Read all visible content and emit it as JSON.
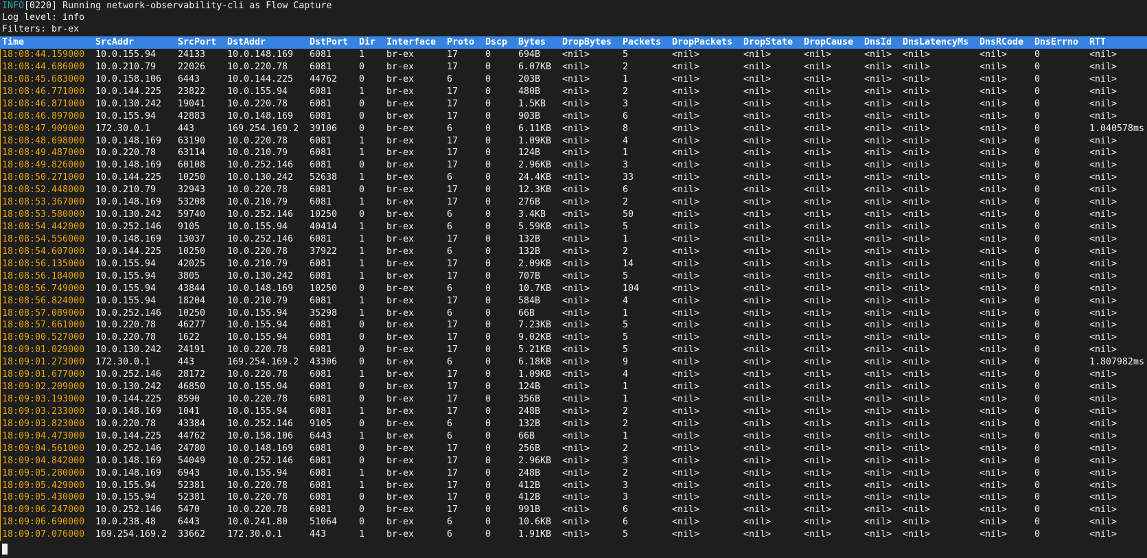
{
  "log": {
    "info_tag": "INFO",
    "info_message": "[0220] Running network-observability-cli as Flow Capture",
    "log_level": "Log level: info",
    "filters": "Filters: br-ex"
  },
  "colors": {
    "background": "#1e1e1e",
    "header_bg": "#3584e4",
    "time_text": "#e5a50a",
    "info_tag": "#2aa1b3",
    "text": "#f0f0f0"
  },
  "table": {
    "columns": [
      "Time",
      "SrcAddr",
      "SrcPort",
      "DstAddr",
      "DstPort",
      "Dir",
      "Interface",
      "Proto",
      "Dscp",
      "Bytes",
      "DropBytes",
      "Packets",
      "DropPackets",
      "DropState",
      "DropCause",
      "DnsId",
      "DnsLatencyMs",
      "DnsRCode",
      "DnsErrno",
      "RTT"
    ],
    "rows": [
      [
        "18:08:44.159000",
        "10.0.155.94",
        "24133",
        "10.0.148.169",
        "6081",
        "1",
        "br-ex",
        "17",
        "0",
        "694B",
        "<nil>",
        "5",
        "<nil>",
        "<nil>",
        "<nil>",
        "<nil>",
        "<nil>",
        "<nil>",
        "0",
        "<nil>"
      ],
      [
        "18:08:44.686000",
        "10.0.210.79",
        "22026",
        "10.0.220.78",
        "6081",
        "0",
        "br-ex",
        "17",
        "0",
        "6.07KB",
        "<nil>",
        "2",
        "<nil>",
        "<nil>",
        "<nil>",
        "<nil>",
        "<nil>",
        "<nil>",
        "0",
        "<nil>"
      ],
      [
        "18:08:45.683000",
        "10.0.158.106",
        "6443",
        "10.0.144.225",
        "44762",
        "0",
        "br-ex",
        "6",
        "0",
        "203B",
        "<nil>",
        "1",
        "<nil>",
        "<nil>",
        "<nil>",
        "<nil>",
        "<nil>",
        "<nil>",
        "0",
        "<nil>"
      ],
      [
        "18:08:46.771000",
        "10.0.144.225",
        "23822",
        "10.0.155.94",
        "6081",
        "1",
        "br-ex",
        "17",
        "0",
        "480B",
        "<nil>",
        "2",
        "<nil>",
        "<nil>",
        "<nil>",
        "<nil>",
        "<nil>",
        "<nil>",
        "0",
        "<nil>"
      ],
      [
        "18:08:46.871000",
        "10.0.130.242",
        "19041",
        "10.0.220.78",
        "6081",
        "0",
        "br-ex",
        "17",
        "0",
        "1.5KB",
        "<nil>",
        "3",
        "<nil>",
        "<nil>",
        "<nil>",
        "<nil>",
        "<nil>",
        "<nil>",
        "0",
        "<nil>"
      ],
      [
        "18:08:46.897000",
        "10.0.155.94",
        "42883",
        "10.0.148.169",
        "6081",
        "0",
        "br-ex",
        "17",
        "0",
        "903B",
        "<nil>",
        "6",
        "<nil>",
        "<nil>",
        "<nil>",
        "<nil>",
        "<nil>",
        "<nil>",
        "0",
        "<nil>"
      ],
      [
        "18:08:47.909000",
        "172.30.0.1",
        "443",
        "169.254.169.2",
        "39106",
        "0",
        "br-ex",
        "6",
        "0",
        "6.11KB",
        "<nil>",
        "8",
        "<nil>",
        "<nil>",
        "<nil>",
        "<nil>",
        "<nil>",
        "<nil>",
        "0",
        "1.040578ms"
      ],
      [
        "18:08:48.698000",
        "10.0.148.169",
        "63190",
        "10.0.220.78",
        "6081",
        "1",
        "br-ex",
        "17",
        "0",
        "1.09KB",
        "<nil>",
        "4",
        "<nil>",
        "<nil>",
        "<nil>",
        "<nil>",
        "<nil>",
        "<nil>",
        "0",
        "<nil>"
      ],
      [
        "18:08:49.487000",
        "10.0.220.78",
        "63114",
        "10.0.210.79",
        "6081",
        "1",
        "br-ex",
        "17",
        "0",
        "124B",
        "<nil>",
        "1",
        "<nil>",
        "<nil>",
        "<nil>",
        "<nil>",
        "<nil>",
        "<nil>",
        "0",
        "<nil>"
      ],
      [
        "18:08:49.826000",
        "10.0.148.169",
        "60108",
        "10.0.252.146",
        "6081",
        "0",
        "br-ex",
        "17",
        "0",
        "2.96KB",
        "<nil>",
        "3",
        "<nil>",
        "<nil>",
        "<nil>",
        "<nil>",
        "<nil>",
        "<nil>",
        "0",
        "<nil>"
      ],
      [
        "18:08:50.271000",
        "10.0.144.225",
        "10250",
        "10.0.130.242",
        "52638",
        "1",
        "br-ex",
        "6",
        "0",
        "24.4KB",
        "<nil>",
        "33",
        "<nil>",
        "<nil>",
        "<nil>",
        "<nil>",
        "<nil>",
        "<nil>",
        "0",
        "<nil>"
      ],
      [
        "18:08:52.448000",
        "10.0.210.79",
        "32943",
        "10.0.220.78",
        "6081",
        "0",
        "br-ex",
        "17",
        "0",
        "12.3KB",
        "<nil>",
        "6",
        "<nil>",
        "<nil>",
        "<nil>",
        "<nil>",
        "<nil>",
        "<nil>",
        "0",
        "<nil>"
      ],
      [
        "18:08:53.367000",
        "10.0.148.169",
        "53208",
        "10.0.210.79",
        "6081",
        "1",
        "br-ex",
        "17",
        "0",
        "276B",
        "<nil>",
        "2",
        "<nil>",
        "<nil>",
        "<nil>",
        "<nil>",
        "<nil>",
        "<nil>",
        "0",
        "<nil>"
      ],
      [
        "18:08:53.580000",
        "10.0.130.242",
        "59740",
        "10.0.252.146",
        "10250",
        "0",
        "br-ex",
        "6",
        "0",
        "3.4KB",
        "<nil>",
        "50",
        "<nil>",
        "<nil>",
        "<nil>",
        "<nil>",
        "<nil>",
        "<nil>",
        "0",
        "<nil>"
      ],
      [
        "18:08:54.442000",
        "10.0.252.146",
        "9105",
        "10.0.155.94",
        "40414",
        "1",
        "br-ex",
        "6",
        "0",
        "5.59KB",
        "<nil>",
        "5",
        "<nil>",
        "<nil>",
        "<nil>",
        "<nil>",
        "<nil>",
        "<nil>",
        "0",
        "<nil>"
      ],
      [
        "18:08:54.556000",
        "10.0.148.169",
        "13037",
        "10.0.252.146",
        "6081",
        "1",
        "br-ex",
        "17",
        "0",
        "132B",
        "<nil>",
        "1",
        "<nil>",
        "<nil>",
        "<nil>",
        "<nil>",
        "<nil>",
        "<nil>",
        "0",
        "<nil>"
      ],
      [
        "18:08:54.607000",
        "10.0.144.225",
        "10250",
        "10.0.220.78",
        "37922",
        "1",
        "br-ex",
        "6",
        "0",
        "132B",
        "<nil>",
        "2",
        "<nil>",
        "<nil>",
        "<nil>",
        "<nil>",
        "<nil>",
        "<nil>",
        "0",
        "<nil>"
      ],
      [
        "18:08:56.135000",
        "10.0.155.94",
        "42025",
        "10.0.210.79",
        "6081",
        "1",
        "br-ex",
        "17",
        "0",
        "2.09KB",
        "<nil>",
        "14",
        "<nil>",
        "<nil>",
        "<nil>",
        "<nil>",
        "<nil>",
        "<nil>",
        "0",
        "<nil>"
      ],
      [
        "18:08:56.184000",
        "10.0.155.94",
        "3805",
        "10.0.130.242",
        "6081",
        "1",
        "br-ex",
        "17",
        "0",
        "707B",
        "<nil>",
        "5",
        "<nil>",
        "<nil>",
        "<nil>",
        "<nil>",
        "<nil>",
        "<nil>",
        "0",
        "<nil>"
      ],
      [
        "18:08:56.749000",
        "10.0.155.94",
        "43844",
        "10.0.148.169",
        "10250",
        "0",
        "br-ex",
        "6",
        "0",
        "10.7KB",
        "<nil>",
        "104",
        "<nil>",
        "<nil>",
        "<nil>",
        "<nil>",
        "<nil>",
        "<nil>",
        "0",
        "<nil>"
      ],
      [
        "18:08:56.824000",
        "10.0.155.94",
        "18204",
        "10.0.210.79",
        "6081",
        "1",
        "br-ex",
        "17",
        "0",
        "584B",
        "<nil>",
        "4",
        "<nil>",
        "<nil>",
        "<nil>",
        "<nil>",
        "<nil>",
        "<nil>",
        "0",
        "<nil>"
      ],
      [
        "18:08:57.089000",
        "10.0.252.146",
        "10250",
        "10.0.155.94",
        "35298",
        "1",
        "br-ex",
        "6",
        "0",
        "66B",
        "<nil>",
        "1",
        "<nil>",
        "<nil>",
        "<nil>",
        "<nil>",
        "<nil>",
        "<nil>",
        "0",
        "<nil>"
      ],
      [
        "18:08:57.661000",
        "10.0.220.78",
        "46277",
        "10.0.155.94",
        "6081",
        "0",
        "br-ex",
        "17",
        "0",
        "7.23KB",
        "<nil>",
        "5",
        "<nil>",
        "<nil>",
        "<nil>",
        "<nil>",
        "<nil>",
        "<nil>",
        "0",
        "<nil>"
      ],
      [
        "18:09:00.527000",
        "10.0.220.78",
        "1622",
        "10.0.155.94",
        "6081",
        "0",
        "br-ex",
        "17",
        "0",
        "9.02KB",
        "<nil>",
        "5",
        "<nil>",
        "<nil>",
        "<nil>",
        "<nil>",
        "<nil>",
        "<nil>",
        "0",
        "<nil>"
      ],
      [
        "18:09:01.029000",
        "10.0.130.242",
        "24191",
        "10.0.220.78",
        "6081",
        "0",
        "br-ex",
        "17",
        "0",
        "5.21KB",
        "<nil>",
        "5",
        "<nil>",
        "<nil>",
        "<nil>",
        "<nil>",
        "<nil>",
        "<nil>",
        "0",
        "<nil>"
      ],
      [
        "18:09:01.273000",
        "172.30.0.1",
        "443",
        "169.254.169.2",
        "43306",
        "0",
        "br-ex",
        "6",
        "0",
        "6.18KB",
        "<nil>",
        "9",
        "<nil>",
        "<nil>",
        "<nil>",
        "<nil>",
        "<nil>",
        "<nil>",
        "0",
        "1.807982ms"
      ],
      [
        "18:09:01.677000",
        "10.0.252.146",
        "28172",
        "10.0.220.78",
        "6081",
        "1",
        "br-ex",
        "17",
        "0",
        "1.09KB",
        "<nil>",
        "4",
        "<nil>",
        "<nil>",
        "<nil>",
        "<nil>",
        "<nil>",
        "<nil>",
        "0",
        "<nil>"
      ],
      [
        "18:09:02.209000",
        "10.0.130.242",
        "46850",
        "10.0.155.94",
        "6081",
        "0",
        "br-ex",
        "17",
        "0",
        "124B",
        "<nil>",
        "1",
        "<nil>",
        "<nil>",
        "<nil>",
        "<nil>",
        "<nil>",
        "<nil>",
        "0",
        "<nil>"
      ],
      [
        "18:09:03.193000",
        "10.0.144.225",
        "8590",
        "10.0.220.78",
        "6081",
        "0",
        "br-ex",
        "17",
        "0",
        "356B",
        "<nil>",
        "1",
        "<nil>",
        "<nil>",
        "<nil>",
        "<nil>",
        "<nil>",
        "<nil>",
        "0",
        "<nil>"
      ],
      [
        "18:09:03.233000",
        "10.0.148.169",
        "1041",
        "10.0.155.94",
        "6081",
        "1",
        "br-ex",
        "17",
        "0",
        "248B",
        "<nil>",
        "2",
        "<nil>",
        "<nil>",
        "<nil>",
        "<nil>",
        "<nil>",
        "<nil>",
        "0",
        "<nil>"
      ],
      [
        "18:09:03.823000",
        "10.0.220.78",
        "43384",
        "10.0.252.146",
        "9105",
        "0",
        "br-ex",
        "6",
        "0",
        "132B",
        "<nil>",
        "2",
        "<nil>",
        "<nil>",
        "<nil>",
        "<nil>",
        "<nil>",
        "<nil>",
        "0",
        "<nil>"
      ],
      [
        "18:09:04.473000",
        "10.0.144.225",
        "44762",
        "10.0.158.106",
        "6443",
        "1",
        "br-ex",
        "6",
        "0",
        "66B",
        "<nil>",
        "1",
        "<nil>",
        "<nil>",
        "<nil>",
        "<nil>",
        "<nil>",
        "<nil>",
        "0",
        "<nil>"
      ],
      [
        "18:09:04.561000",
        "10.0.252.146",
        "24780",
        "10.0.148.169",
        "6081",
        "0",
        "br-ex",
        "17",
        "0",
        "256B",
        "<nil>",
        "2",
        "<nil>",
        "<nil>",
        "<nil>",
        "<nil>",
        "<nil>",
        "<nil>",
        "0",
        "<nil>"
      ],
      [
        "18:09:04.842000",
        "10.0.148.169",
        "54049",
        "10.0.252.146",
        "6081",
        "0",
        "br-ex",
        "17",
        "0",
        "2.96KB",
        "<nil>",
        "3",
        "<nil>",
        "<nil>",
        "<nil>",
        "<nil>",
        "<nil>",
        "<nil>",
        "0",
        "<nil>"
      ],
      [
        "18:09:05.280000",
        "10.0.148.169",
        "6943",
        "10.0.155.94",
        "6081",
        "1",
        "br-ex",
        "17",
        "0",
        "248B",
        "<nil>",
        "2",
        "<nil>",
        "<nil>",
        "<nil>",
        "<nil>",
        "<nil>",
        "<nil>",
        "0",
        "<nil>"
      ],
      [
        "18:09:05.429000",
        "10.0.155.94",
        "52381",
        "10.0.220.78",
        "6081",
        "1",
        "br-ex",
        "17",
        "0",
        "412B",
        "<nil>",
        "3",
        "<nil>",
        "<nil>",
        "<nil>",
        "<nil>",
        "<nil>",
        "<nil>",
        "0",
        "<nil>"
      ],
      [
        "18:09:05.430000",
        "10.0.155.94",
        "52381",
        "10.0.220.78",
        "6081",
        "0",
        "br-ex",
        "17",
        "0",
        "412B",
        "<nil>",
        "3",
        "<nil>",
        "<nil>",
        "<nil>",
        "<nil>",
        "<nil>",
        "<nil>",
        "0",
        "<nil>"
      ],
      [
        "18:09:06.247000",
        "10.0.252.146",
        "5470",
        "10.0.220.78",
        "6081",
        "0",
        "br-ex",
        "17",
        "0",
        "991B",
        "<nil>",
        "6",
        "<nil>",
        "<nil>",
        "<nil>",
        "<nil>",
        "<nil>",
        "<nil>",
        "0",
        "<nil>"
      ],
      [
        "18:09:06.690000",
        "10.0.238.48",
        "6443",
        "10.0.241.80",
        "51064",
        "0",
        "br-ex",
        "6",
        "0",
        "10.6KB",
        "<nil>",
        "6",
        "<nil>",
        "<nil>",
        "<nil>",
        "<nil>",
        "<nil>",
        "<nil>",
        "0",
        "<nil>"
      ],
      [
        "18:09:07.076000",
        "169.254.169.2",
        "33662",
        "172.30.0.1",
        "443",
        "1",
        "br-ex",
        "6",
        "0",
        "1.91KB",
        "<nil>",
        "5",
        "<nil>",
        "<nil>",
        "<nil>",
        "<nil>",
        "<nil>",
        "<nil>",
        "0",
        "<nil>"
      ]
    ]
  }
}
